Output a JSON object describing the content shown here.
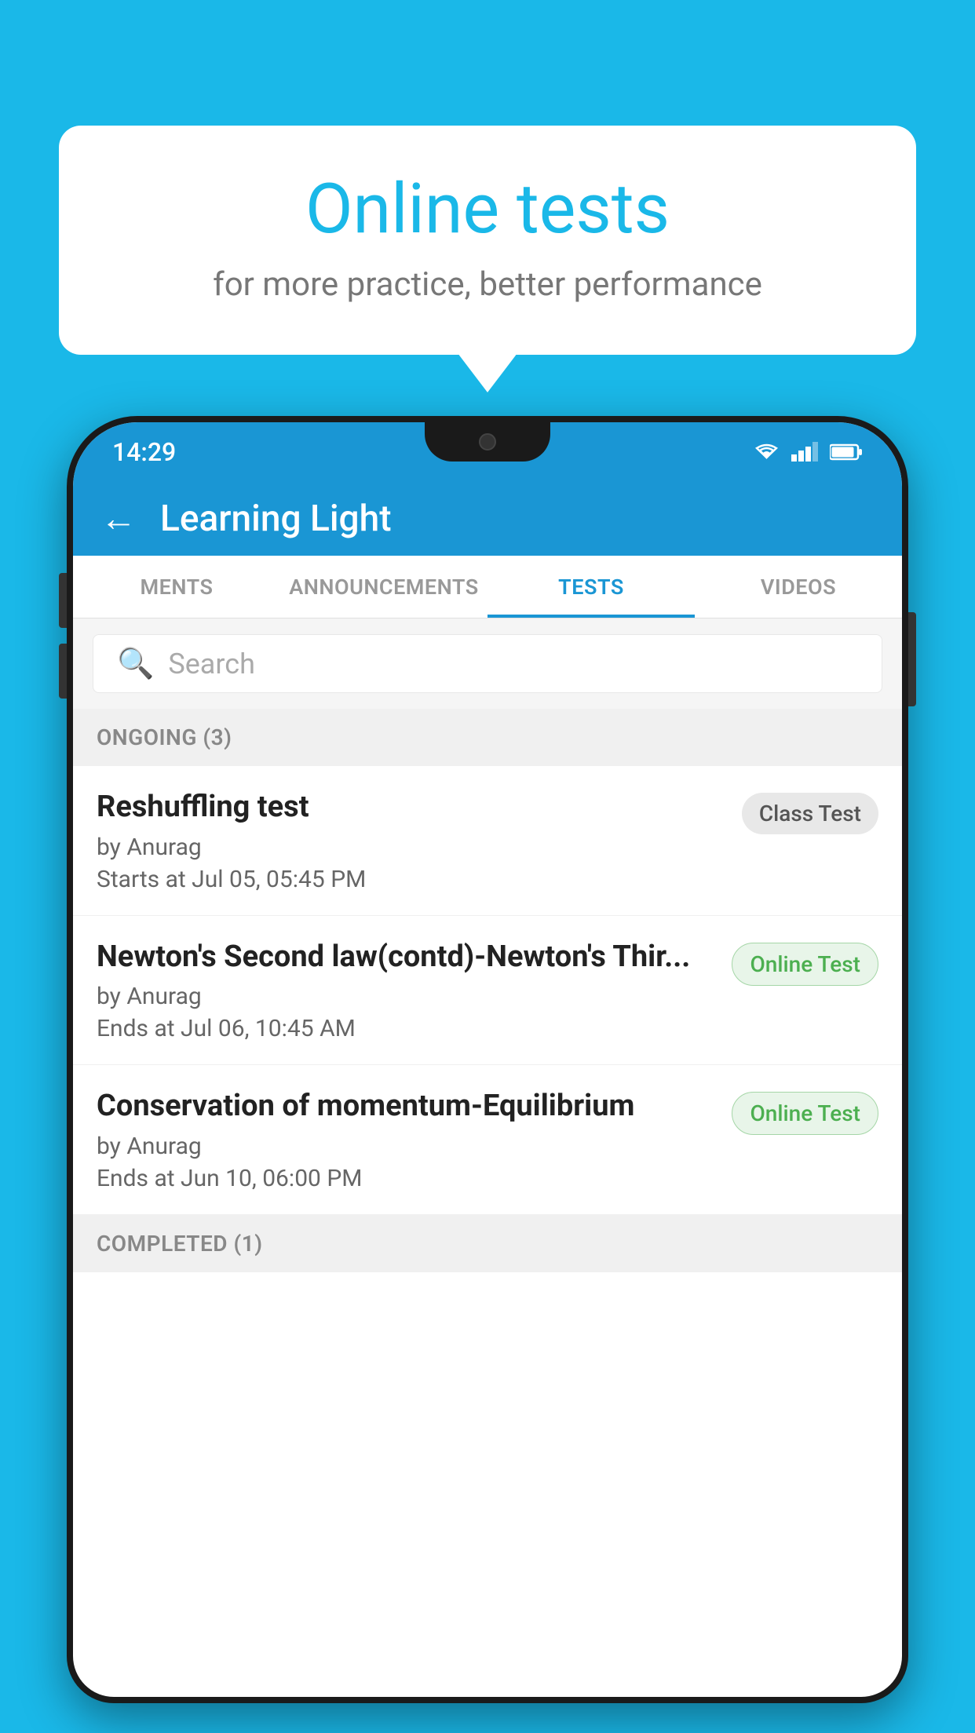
{
  "background": {
    "color": "#1ab8e8"
  },
  "speech_bubble": {
    "title": "Online tests",
    "subtitle": "for more practice, better performance"
  },
  "phone": {
    "status_bar": {
      "time": "14:29",
      "icons": [
        "wifi",
        "signal",
        "battery"
      ]
    },
    "header": {
      "title": "Learning Light",
      "back_label": "←"
    },
    "tabs": [
      {
        "label": "MENTS",
        "active": false
      },
      {
        "label": "ANNOUNCEMENTS",
        "active": false
      },
      {
        "label": "TESTS",
        "active": true
      },
      {
        "label": "VIDEOS",
        "active": false
      }
    ],
    "search": {
      "placeholder": "Search"
    },
    "ongoing_section": {
      "label": "ONGOING (3)"
    },
    "tests": [
      {
        "title": "Reshuffling test",
        "author": "by Anurag",
        "date": "Starts at  Jul 05, 05:45 PM",
        "badge": "Class Test",
        "badge_type": "class"
      },
      {
        "title": "Newton's Second law(contd)-Newton's Thir...",
        "author": "by Anurag",
        "date": "Ends at  Jul 06, 10:45 AM",
        "badge": "Online Test",
        "badge_type": "online"
      },
      {
        "title": "Conservation of momentum-Equilibrium",
        "author": "by Anurag",
        "date": "Ends at  Jun 10, 06:00 PM",
        "badge": "Online Test",
        "badge_type": "online"
      }
    ],
    "completed_section": {
      "label": "COMPLETED (1)"
    }
  }
}
